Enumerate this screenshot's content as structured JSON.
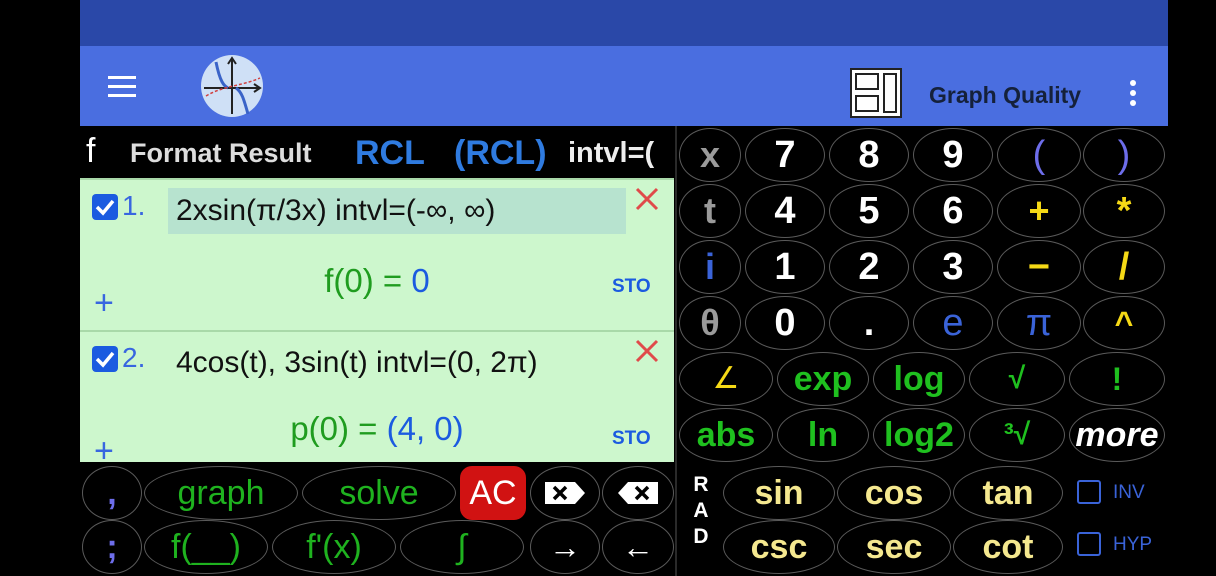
{
  "toolbar": {
    "menu_icon": "hamburger-menu-icon",
    "logo_icon": "graph-logo-icon",
    "layout_icon": "layout-panels-icon",
    "graph_quality_label": "Graph Quality",
    "more_icon": "more-vertical-icon"
  },
  "funcbar": {
    "f_label": "f",
    "format_result": "Format Result",
    "rcl": "RCL",
    "rcl_paren": "(RCL)",
    "intvl": "intvl=("
  },
  "entries": [
    {
      "checked": true,
      "number": "1.",
      "expression": "2xsin(π/3x)   intvl=(-∞, ∞)",
      "result_label": "f(0) = ",
      "result_value": "0",
      "sto": "STO",
      "plus": "+"
    },
    {
      "checked": true,
      "number": "2.",
      "expression": "4cos(t), 3sin(t)   intvl=(0, 2π)",
      "result_label": "p(0) = ",
      "result_value": "(4, 0)",
      "sto": "STO",
      "plus": "+"
    }
  ],
  "bottom_keys": {
    "comma": ",",
    "semicolon": ";",
    "graph": "graph",
    "solve": "solve",
    "ac": "AC",
    "f_blank": "f(__)",
    "f_prime": "f'(x)",
    "integral": "∫",
    "right_arrow": "→",
    "left_arrow": "←"
  },
  "right_keys": {
    "row1": [
      "x",
      "7",
      "8",
      "9",
      "(",
      ")"
    ],
    "row2": [
      "t",
      "4",
      "5",
      "6",
      "+",
      "*"
    ],
    "row3": [
      "i",
      "1",
      "2",
      "3",
      "−",
      "/"
    ],
    "row4": [
      "θ",
      "0",
      ".",
      "e",
      "π",
      "^"
    ],
    "row5": [
      "∠",
      "exp",
      "log",
      "√",
      "!"
    ],
    "row6": [
      "abs",
      "ln",
      "log2",
      "³√",
      "more"
    ],
    "rad": [
      "R",
      "A",
      "D"
    ],
    "trig1": [
      "sin",
      "cos",
      "tan"
    ],
    "trig2": [
      "csc",
      "sec",
      "cot"
    ],
    "inv": "INV",
    "hyp": "HYP"
  },
  "colors": {
    "statusbar": "#2a48a8",
    "toolbar": "#4a6ee0",
    "entry_bg": "#cdf7cd",
    "green_text": "#1f9c1f",
    "blue_text": "#1b5be0",
    "yellow_key": "#f5d916",
    "purple_key": "#6d6dea",
    "ac_red": "#d11212"
  }
}
